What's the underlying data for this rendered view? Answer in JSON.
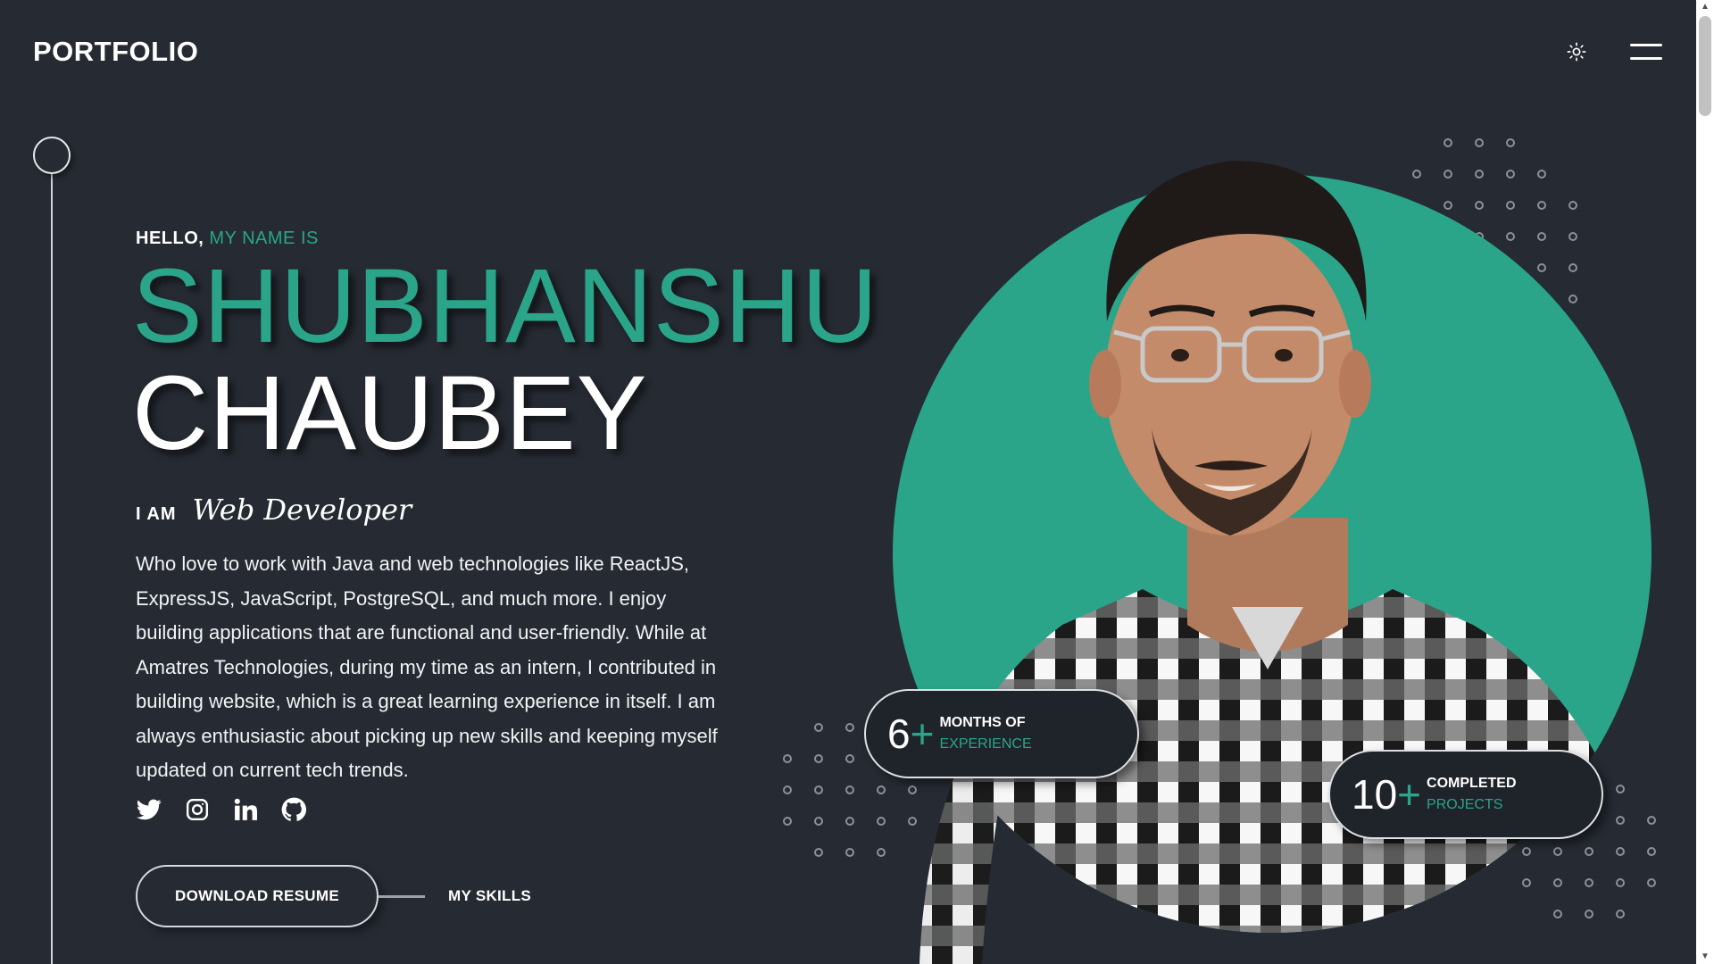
{
  "header": {
    "logo": "PORTFOLIO",
    "theme_icon": "sun-icon",
    "menu_icon": "hamburger-menu-icon"
  },
  "hero": {
    "greeting_hello": "HELLO,",
    "greeting_accent": "MY NAME IS",
    "first_name": "SHUBHANSHU",
    "last_name": "CHAUBEY",
    "role_prefix": "I AM",
    "role_title": "Web Developer",
    "bio": "Who love to work with Java and web technologies like ReactJS, ExpressJS, JavaScript, PostgreSQL, and much more. I enjoy building applications that are functional and user-friendly. While at Amatres Technologies, during my time as an intern, I contributed in building website, which is a great learning experience in itself. I am always enthusiastic about picking up new skills and keeping myself updated on current tech trends.",
    "socials": [
      "twitter-icon",
      "instagram-icon",
      "linkedin-icon",
      "github-icon"
    ],
    "download_resume": "DOWNLOAD RESUME",
    "my_skills": "MY SKILLS"
  },
  "stats": [
    {
      "number": "6",
      "plus": "+",
      "line1": "MONTHS OF",
      "line2": "EXPERIENCE"
    },
    {
      "number": "10",
      "plus": "+",
      "line1": "COMPLETED",
      "line2": "PROJECTS"
    }
  ],
  "colors": {
    "background": "#262b33",
    "accent": "#2aa58a",
    "card": "#1f232a"
  }
}
